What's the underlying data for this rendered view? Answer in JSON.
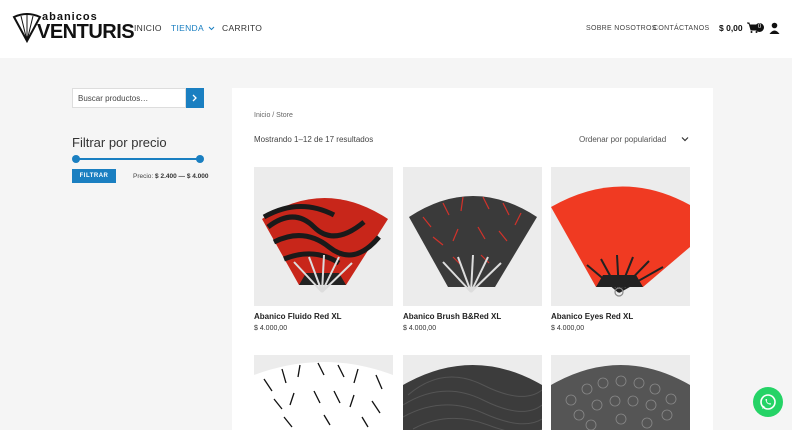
{
  "header": {
    "logo_top": "abanicos",
    "logo_main": "VENTURIS",
    "nav": [
      "INICIO",
      "TIENDA",
      "CARRITO"
    ],
    "nav_right": [
      "SOBRE NOSOTROS",
      "CONTÁCTANOS"
    ],
    "cart_total": "$ 0,00",
    "cart_count": "0"
  },
  "sidebar": {
    "search_placeholder": "Buscar productos…",
    "filter_title": "Filtrar por precio",
    "filter_button": "FILTRAR",
    "price_label": "Precio:",
    "price_range": "$ 2.400 — $ 4.000"
  },
  "main": {
    "breadcrumb": "Inicio / Store",
    "results": "Mostrando 1–12 de 17 resultados",
    "orderby": "Ordenar por popularidad",
    "products": [
      {
        "title": "Abanico Fluido Red XL",
        "price": "$ 4.000,00"
      },
      {
        "title": "Abanico Brush B&Red XL",
        "price": "$ 4.000,00"
      },
      {
        "title": "Abanico Eyes Red XL",
        "price": "$ 4.000,00"
      },
      {
        "title": "",
        "price": ""
      },
      {
        "title": "",
        "price": ""
      },
      {
        "title": "",
        "price": ""
      }
    ]
  },
  "colors": {
    "accent": "#1a7fc1",
    "whatsapp": "#25d366",
    "fan_red": "#e8321e"
  },
  "icons": [
    "search-arrow-icon",
    "chevron-down-icon",
    "cart-icon",
    "user-icon",
    "whatsapp-icon",
    "fan-logo-icon"
  ]
}
